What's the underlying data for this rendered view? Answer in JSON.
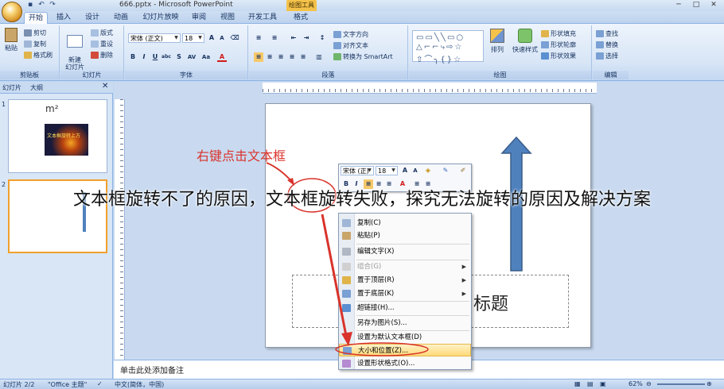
{
  "window": {
    "title": "666.pptx - Microsoft PowerPoint",
    "contextual_tab": "绘图工具",
    "controls": [
      "─",
      "□",
      "✕"
    ]
  },
  "tabs": [
    "开始",
    "插入",
    "设计",
    "动画",
    "幻灯片放映",
    "审阅",
    "视图",
    "开发工具",
    "格式"
  ],
  "ribbon": {
    "clipboard": {
      "label": "剪贴板",
      "paste": "粘贴",
      "cut": "剪切",
      "copy": "复制",
      "format_painter": "格式刷"
    },
    "slides": {
      "label": "幻灯片",
      "new_slide": "新建\n幻灯片",
      "layout": "版式",
      "reset": "重设",
      "delete": "删除"
    },
    "font": {
      "label": "字体",
      "font_name": "宋体 (正文)",
      "font_size": "18"
    },
    "paragraph": {
      "label": "段落",
      "text_direction": "文字方向",
      "align_text": "对齐文本",
      "smartart": "转换为 SmartArt"
    },
    "drawing": {
      "label": "绘图",
      "arrange": "排列",
      "quick_styles": "快速样式",
      "shape_fill": "形状填充",
      "shape_outline": "形状轮廓",
      "shape_effects": "形状效果"
    },
    "editing": {
      "label": "编辑",
      "find": "查找",
      "replace": "替换",
      "select": "选择"
    }
  },
  "left_panel": {
    "tab_slides": "幻灯片",
    "tab_outline": "大纲",
    "slide1_num": "1",
    "slide2_num": "2",
    "slide1_text": "m²",
    "slide1_image_caption": "文本框旋转上方"
  },
  "slide": {
    "title_placeholder": "标题"
  },
  "notes_placeholder": "单击此处添加备注",
  "mini_toolbar": {
    "font": "宋体 (正)",
    "size": "18"
  },
  "context_menu": [
    {
      "label": "复制(C)",
      "disabled": false
    },
    {
      "label": "粘贴(P)",
      "disabled": false
    },
    {
      "label": "编辑文字(X)",
      "disabled": false
    },
    {
      "label": "组合(G)",
      "disabled": true,
      "submenu": true
    },
    {
      "label": "置于顶层(R)",
      "disabled": false,
      "submenu": true
    },
    {
      "label": "置于底层(K)",
      "disabled": false,
      "submenu": true
    },
    {
      "label": "超链接(H)...",
      "disabled": false
    },
    {
      "label": "另存为图片(S)...",
      "disabled": false
    },
    {
      "label": "设置为默认文本框(D)",
      "disabled": false
    },
    {
      "label": "大小和位置(Z)...",
      "disabled": false,
      "highlight": true
    },
    {
      "label": "设置形状格式(O)...",
      "disabled": false
    }
  ],
  "annotation": "右键点击文本框",
  "overlay_title": "文本框旋转不了的原因，文本框旋转失败，探究无法旋转的原因及解决方案",
  "status": {
    "slide_count": "幻灯片 2/2",
    "theme": "\"Office 主题\"",
    "language": "中文(简体，中国)",
    "zoom": "62%"
  }
}
